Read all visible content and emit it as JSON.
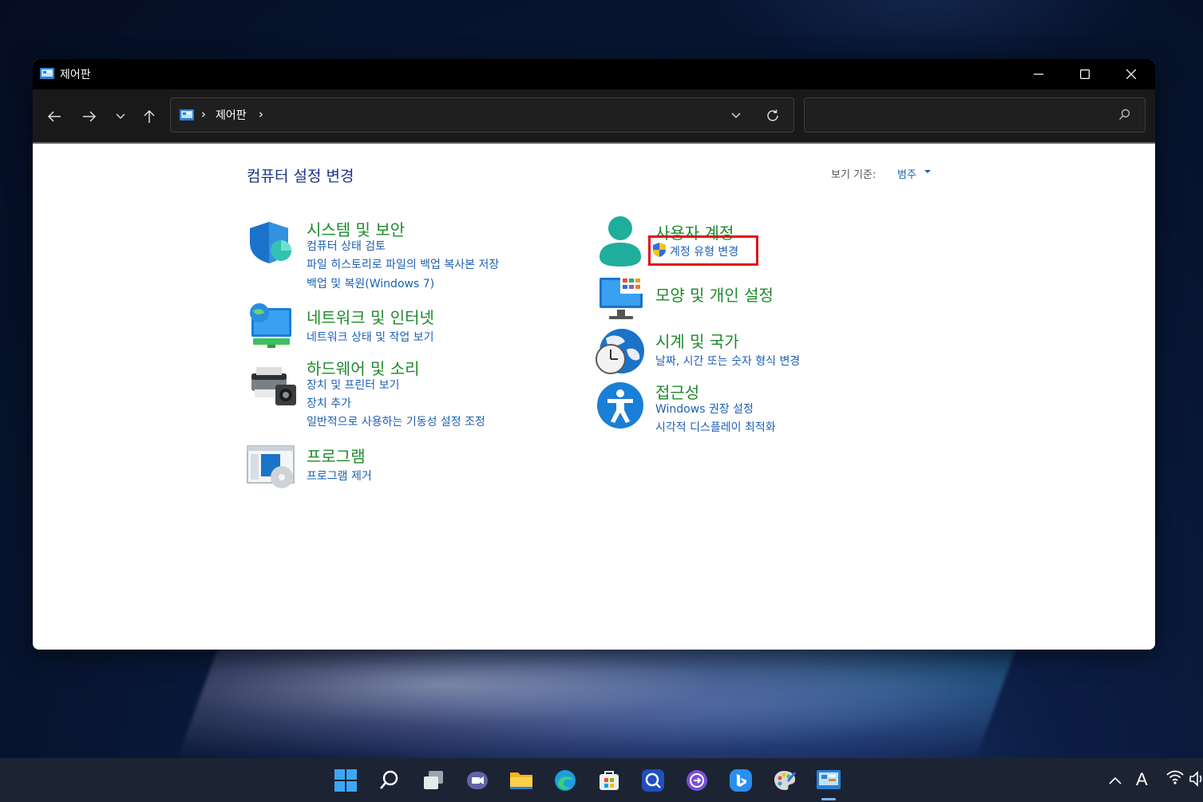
{
  "window": {
    "title": "제어판"
  },
  "address": {
    "path": "제어판",
    "separator": "›",
    "search_placeholder": ""
  },
  "content": {
    "page_title": "컴퓨터 설정 변경",
    "view_by_label": "보기 기준:",
    "view_by_value": "범주"
  },
  "categories_left": [
    {
      "title": "시스템 및 보안",
      "icon": "shield-icon",
      "links": [
        "컴퓨터 상태 검토",
        "파일 히스토리로 파일의 백업 복사본 저장",
        "백업 및 복원(Windows 7)"
      ]
    },
    {
      "title": "네트워크 및 인터넷",
      "icon": "network-icon",
      "links": [
        "네트워크 상태 및 작업 보기"
      ]
    },
    {
      "title": "하드웨어 및 소리",
      "icon": "printer-icon",
      "links": [
        "장치 및 프린터 보기",
        "장치 추가",
        "일반적으로 사용하는 기동성 설정 조정"
      ]
    },
    {
      "title": "프로그램",
      "icon": "programs-icon",
      "links": [
        "프로그램 제거"
      ]
    }
  ],
  "categories_right": [
    {
      "title": "사용자 계정",
      "icon": "user-accounts-icon",
      "links": [
        "계정 유형 변경"
      ]
    },
    {
      "title": "모양 및 개인 설정",
      "icon": "appearance-icon",
      "links": []
    },
    {
      "title": "시계 및 국가",
      "icon": "clock-globe-icon",
      "links": [
        "날짜, 시간 또는 숫자 형식 변경"
      ]
    },
    {
      "title": "접근성",
      "icon": "accessibility-icon",
      "links": [
        "Windows 권장 설정",
        "시각적 디스플레이 최적화"
      ]
    }
  ],
  "taskbar": {
    "apps": [
      "start-icon",
      "search-icon",
      "task-view-icon",
      "teams-chat-icon",
      "file-explorer-icon",
      "edge-icon",
      "store-icon",
      "search-app-icon",
      "remote-app-icon",
      "bing-icon",
      "paint-icon",
      "control-panel-icon"
    ],
    "tray_input_indicator": "A"
  },
  "colors": {
    "category_title": "#1e8a2e",
    "link": "#1e5fb5",
    "page_title": "#1e3287",
    "highlight_box": "#e0101a"
  }
}
